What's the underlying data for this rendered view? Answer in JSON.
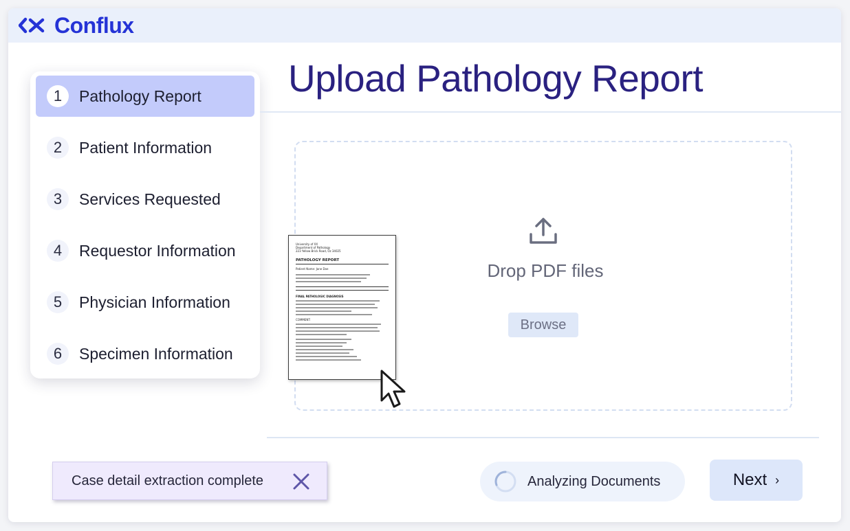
{
  "brand": {
    "name": "Conflux",
    "color": "#2533d6"
  },
  "steps": [
    {
      "number": "1",
      "label": "Pathology Report",
      "active": true
    },
    {
      "number": "2",
      "label": "Patient Information",
      "active": false
    },
    {
      "number": "3",
      "label": "Services Requested",
      "active": false
    },
    {
      "number": "4",
      "label": "Requestor Information",
      "active": false
    },
    {
      "number": "5",
      "label": "Physician Information",
      "active": false
    },
    {
      "number": "6",
      "label": "Specimen Information",
      "active": false
    }
  ],
  "main": {
    "title": "Upload Pathology Report",
    "dropzone": {
      "icon": "upload-icon",
      "text": "Drop PDF files",
      "browse_label": "Browse"
    }
  },
  "document": {
    "header_lines": [
      "University of XX",
      "Department of Pathology",
      "223 Yellow Brick Road, Oz 34025"
    ],
    "title": "PATHOLOGY REPORT",
    "patient_line": "Patient Name: Jane Doe",
    "section_title": "FINAL PATHOLOGIC DIAGNOSIS",
    "comment_label": "COMMENT:"
  },
  "toast": {
    "text": "Case detail extraction complete",
    "icon": "close-icon"
  },
  "status": {
    "text": "Analyzing Documents",
    "icon": "spinner-icon"
  },
  "next_button": {
    "label": "Next",
    "icon": "chevron-right-icon"
  },
  "colors": {
    "title": "#2a2180",
    "active_step": "#c3cbfb",
    "topbar": "#eaf0fb"
  }
}
